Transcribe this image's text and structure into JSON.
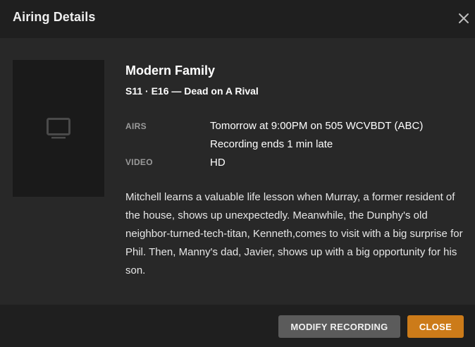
{
  "modal": {
    "title": "Airing Details",
    "close_icon": "close-x-icon"
  },
  "poster": {
    "placeholder_icon": "tv-icon"
  },
  "show": {
    "title": "Modern Family",
    "episode_line": "S11 · E16 — Dead on A Rival"
  },
  "details": {
    "airs_label": "AIRS",
    "airs_value": "Tomorrow at 9:00PM on 505 WCVBDT (ABC)",
    "recording_note": "Recording ends 1 min late",
    "video_label": "VIDEO",
    "video_value": "HD"
  },
  "summary": "Mitchell learns a valuable life lesson when Murray, a former resident of the house, shows up unexpectedly. Meanwhile, the Dunphy's old neighbor-turned-tech-titan, Kenneth,comes to visit with a big surprise for Phil. Then, Manny's dad, Javier, shows up with a big opportunity for his son.",
  "footer": {
    "modify_label": "MODIFY RECORDING",
    "close_label": "CLOSE"
  },
  "colors": {
    "background": "#282828",
    "header_footer": "#1f1f1f",
    "accent": "#cc7b19",
    "secondary_button": "#5b5b5b",
    "label_gray": "#9a9a9a"
  }
}
